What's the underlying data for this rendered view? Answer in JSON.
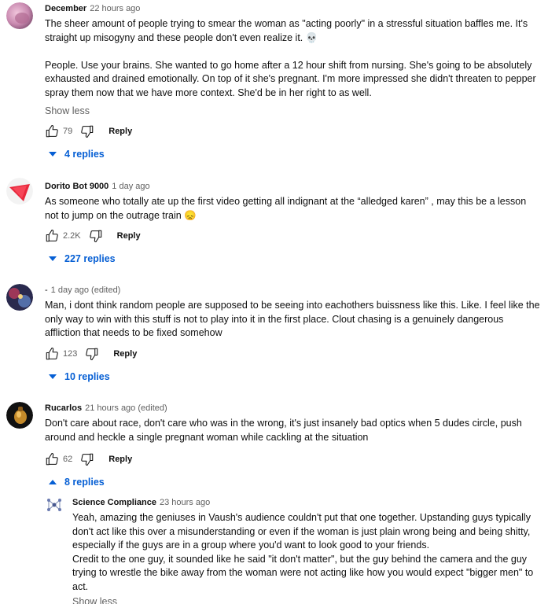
{
  "comments": [
    {
      "author": "December",
      "time": "22 hours ago",
      "paragraphs": [
        "The sheer amount of people trying to smear the woman as \"acting poorly\" in a stressful situation baffles me. It's straight up misogyny and these people don't even realize it. 💀",
        "People. Use your brains. She wanted to go home after a 12 hour shift from nursing. She's going to be absolutely exhausted and drained emotionally. On top of it she's pregnant. I'm more impressed she didn't threaten to pepper spray them now that we have more context. She'd be in her right to as well."
      ],
      "show_less": "Show less",
      "likes": "79",
      "reply_label": "Reply",
      "replies_toggle": "4 replies",
      "avatar_color": "#c98ab0"
    },
    {
      "author": "Dorito Bot 9000",
      "time": "1 day ago",
      "paragraphs": [
        "As someone who totally ate up the first video getting all indignant at the “alledged karen” , may this be a lesson not to jump on the outrage train 😞"
      ],
      "likes": "2.2K",
      "reply_label": "Reply",
      "replies_toggle": "227 replies",
      "avatar_color": "#e8283c"
    },
    {
      "author": "-",
      "time": "1 day ago (edited)",
      "paragraphs": [
        "Man, i dont think random people are supposed to be seeing into eachothers buissness like this. Like. I feel like the only way to win with this stuff is not to play into it in the first place. Clout chasing is a genuinely dangerous affliction that needs to be fixed somehow"
      ],
      "likes": "123",
      "reply_label": "Reply",
      "replies_toggle": "10 replies",
      "avatar_color": "#3a3a6a"
    },
    {
      "author": "Rucarlos",
      "time": "21 hours ago (edited)",
      "paragraphs": [
        "Don't care about race, don't care who was in the wrong, it's just insanely bad optics when 5 dudes circle, push around and heckle a single pregnant woman while cackling at the situation"
      ],
      "likes": "62",
      "reply_label": "Reply",
      "replies_toggle": "8 replies",
      "avatar_color": "#111111"
    }
  ],
  "reply": {
    "author": "Science Compliance",
    "time": "23 hours ago",
    "paragraphs": [
      "Yeah, amazing the geniuses in Vaush's audience couldn't put that one together.  Upstanding guys typically don't act like this over a misunderstanding or even if the woman is just plain wrong being and being shitty, especially if the guys are in a group where you'd want to look good to your friends.",
      "Credit to the one guy, it sounded like he said \"it don't matter\", but the guy behind the camera and the guy trying to wrestle the bike away from the woman were not acting like how you would expect \"bigger men\" to act."
    ],
    "show_less": "Show less"
  },
  "colors": {
    "link_blue": "#065fd4",
    "meta_gray": "#606060"
  },
  "icons": {
    "like": "thumbs-up-icon",
    "dislike": "thumbs-down-icon",
    "expand": "chevron-down-icon",
    "collapse": "chevron-up-icon",
    "molecule": "molecule-icon"
  }
}
